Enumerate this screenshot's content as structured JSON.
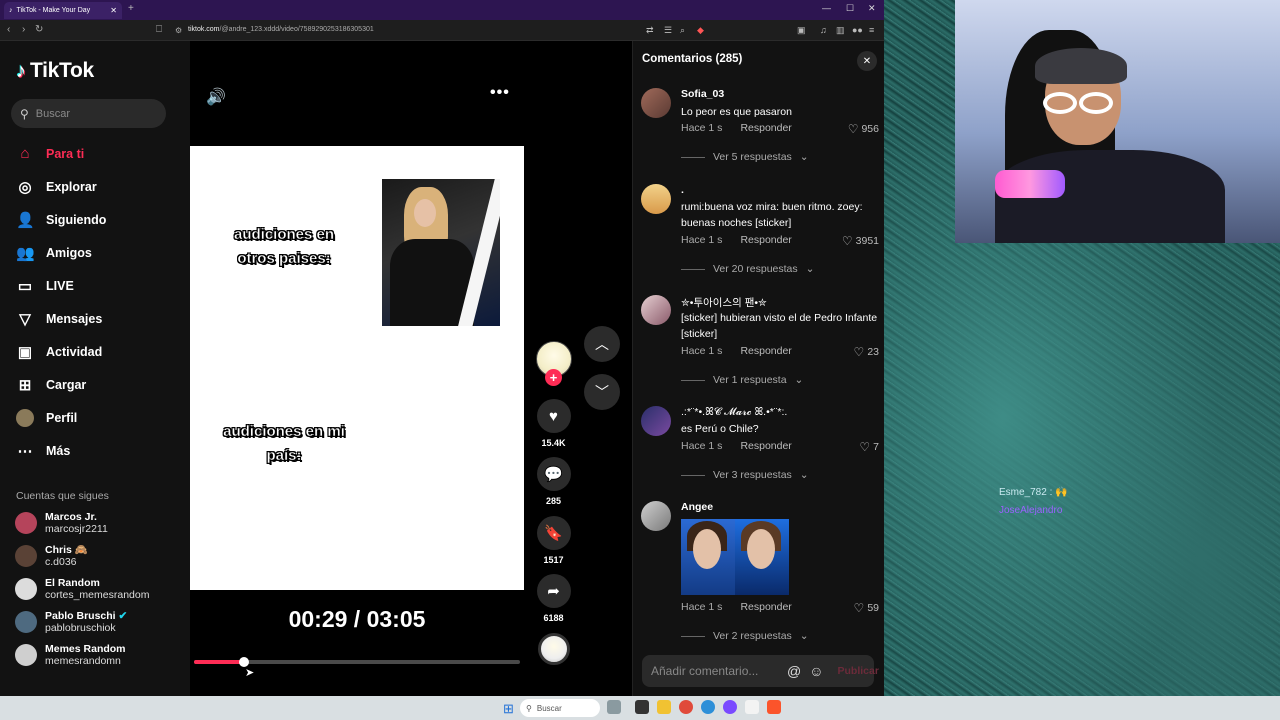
{
  "browser": {
    "tab_title": "TikTok - Make Your Day",
    "url_domain": "tiktok.com",
    "url_path": "/@andre_123.xddd/video/7589290253186305301"
  },
  "sidebar": {
    "logo": "TikTok",
    "search_placeholder": "Buscar",
    "nav": [
      {
        "label": "Para ti",
        "icon": "home-icon"
      },
      {
        "label": "Explorar",
        "icon": "compass-icon"
      },
      {
        "label": "Siguiendo",
        "icon": "following-icon"
      },
      {
        "label": "Amigos",
        "icon": "friends-icon"
      },
      {
        "label": "LIVE",
        "icon": "live-icon"
      },
      {
        "label": "Mensajes",
        "icon": "messages-icon"
      },
      {
        "label": "Actividad",
        "icon": "activity-icon"
      },
      {
        "label": "Cargar",
        "icon": "upload-icon"
      },
      {
        "label": "Perfil",
        "icon": "profile-icon"
      },
      {
        "label": "Más",
        "icon": "more-icon"
      }
    ],
    "following_header": "Cuentas que sigues",
    "following": [
      {
        "name": "Marcos Jr.",
        "handle": "marcosjr2211"
      },
      {
        "name": "Chris 🙈",
        "handle": "c.d036"
      },
      {
        "name": "El Random",
        "handle": "cortes_memesrandom"
      },
      {
        "name": "Pablo Bruschi",
        "handle": "pablobruschiok"
      },
      {
        "name": "Memes Random",
        "handle": "memesrandomn"
      }
    ]
  },
  "video": {
    "caption_top": "audiciones en otros paises:",
    "caption_bottom": "audiciones en mi país:",
    "time": "00:29 / 03:05",
    "progress": 0.152
  },
  "actions": {
    "likes": "15.4K",
    "comments": "285",
    "saves": "1517",
    "shares": "6188"
  },
  "comments_panel": {
    "title": "Comentarios (285)",
    "reply_label": "Responder",
    "input_placeholder": "Añadir comentario...",
    "post_label": "Publicar",
    "items": [
      {
        "user": "Sofia_03",
        "text": "Lo peor es que pasaron",
        "time": "Hace 1 s",
        "likes": "956",
        "replies": "Ver 5 respuestas"
      },
      {
        "user": ".",
        "text": "rumi:buena voz mira: buen ritmo. zoey: buenas noches [sticker]",
        "time": "Hace 1 s",
        "likes": "3951",
        "replies": "Ver 20 respuestas"
      },
      {
        "user": "✮•투아이스의 팬•✮",
        "text": "[sticker] hubieran visto el de Pedro Infante [sticker]",
        "time": "Hace 1 s",
        "likes": "23",
        "replies": "Ver 1 respuesta"
      },
      {
        "user": ".:*¨*•.ꕤ𝓒 𝓜𝓪𝓻𝓬 ꕤ.•*¨*:.",
        "text": "es Perú o Chile?",
        "time": "Hace 1 s",
        "likes": "7",
        "replies": "Ver 3 respuestas"
      },
      {
        "user": "Angee",
        "text": "",
        "time": "Hace 1 s",
        "likes": "59",
        "replies": "Ver 2 respuestas"
      }
    ]
  },
  "overlay_chat": {
    "line1": "Esme_782 : 🙌",
    "line2": "JoseAlejandro"
  },
  "taskbar": {
    "search": "Buscar"
  }
}
